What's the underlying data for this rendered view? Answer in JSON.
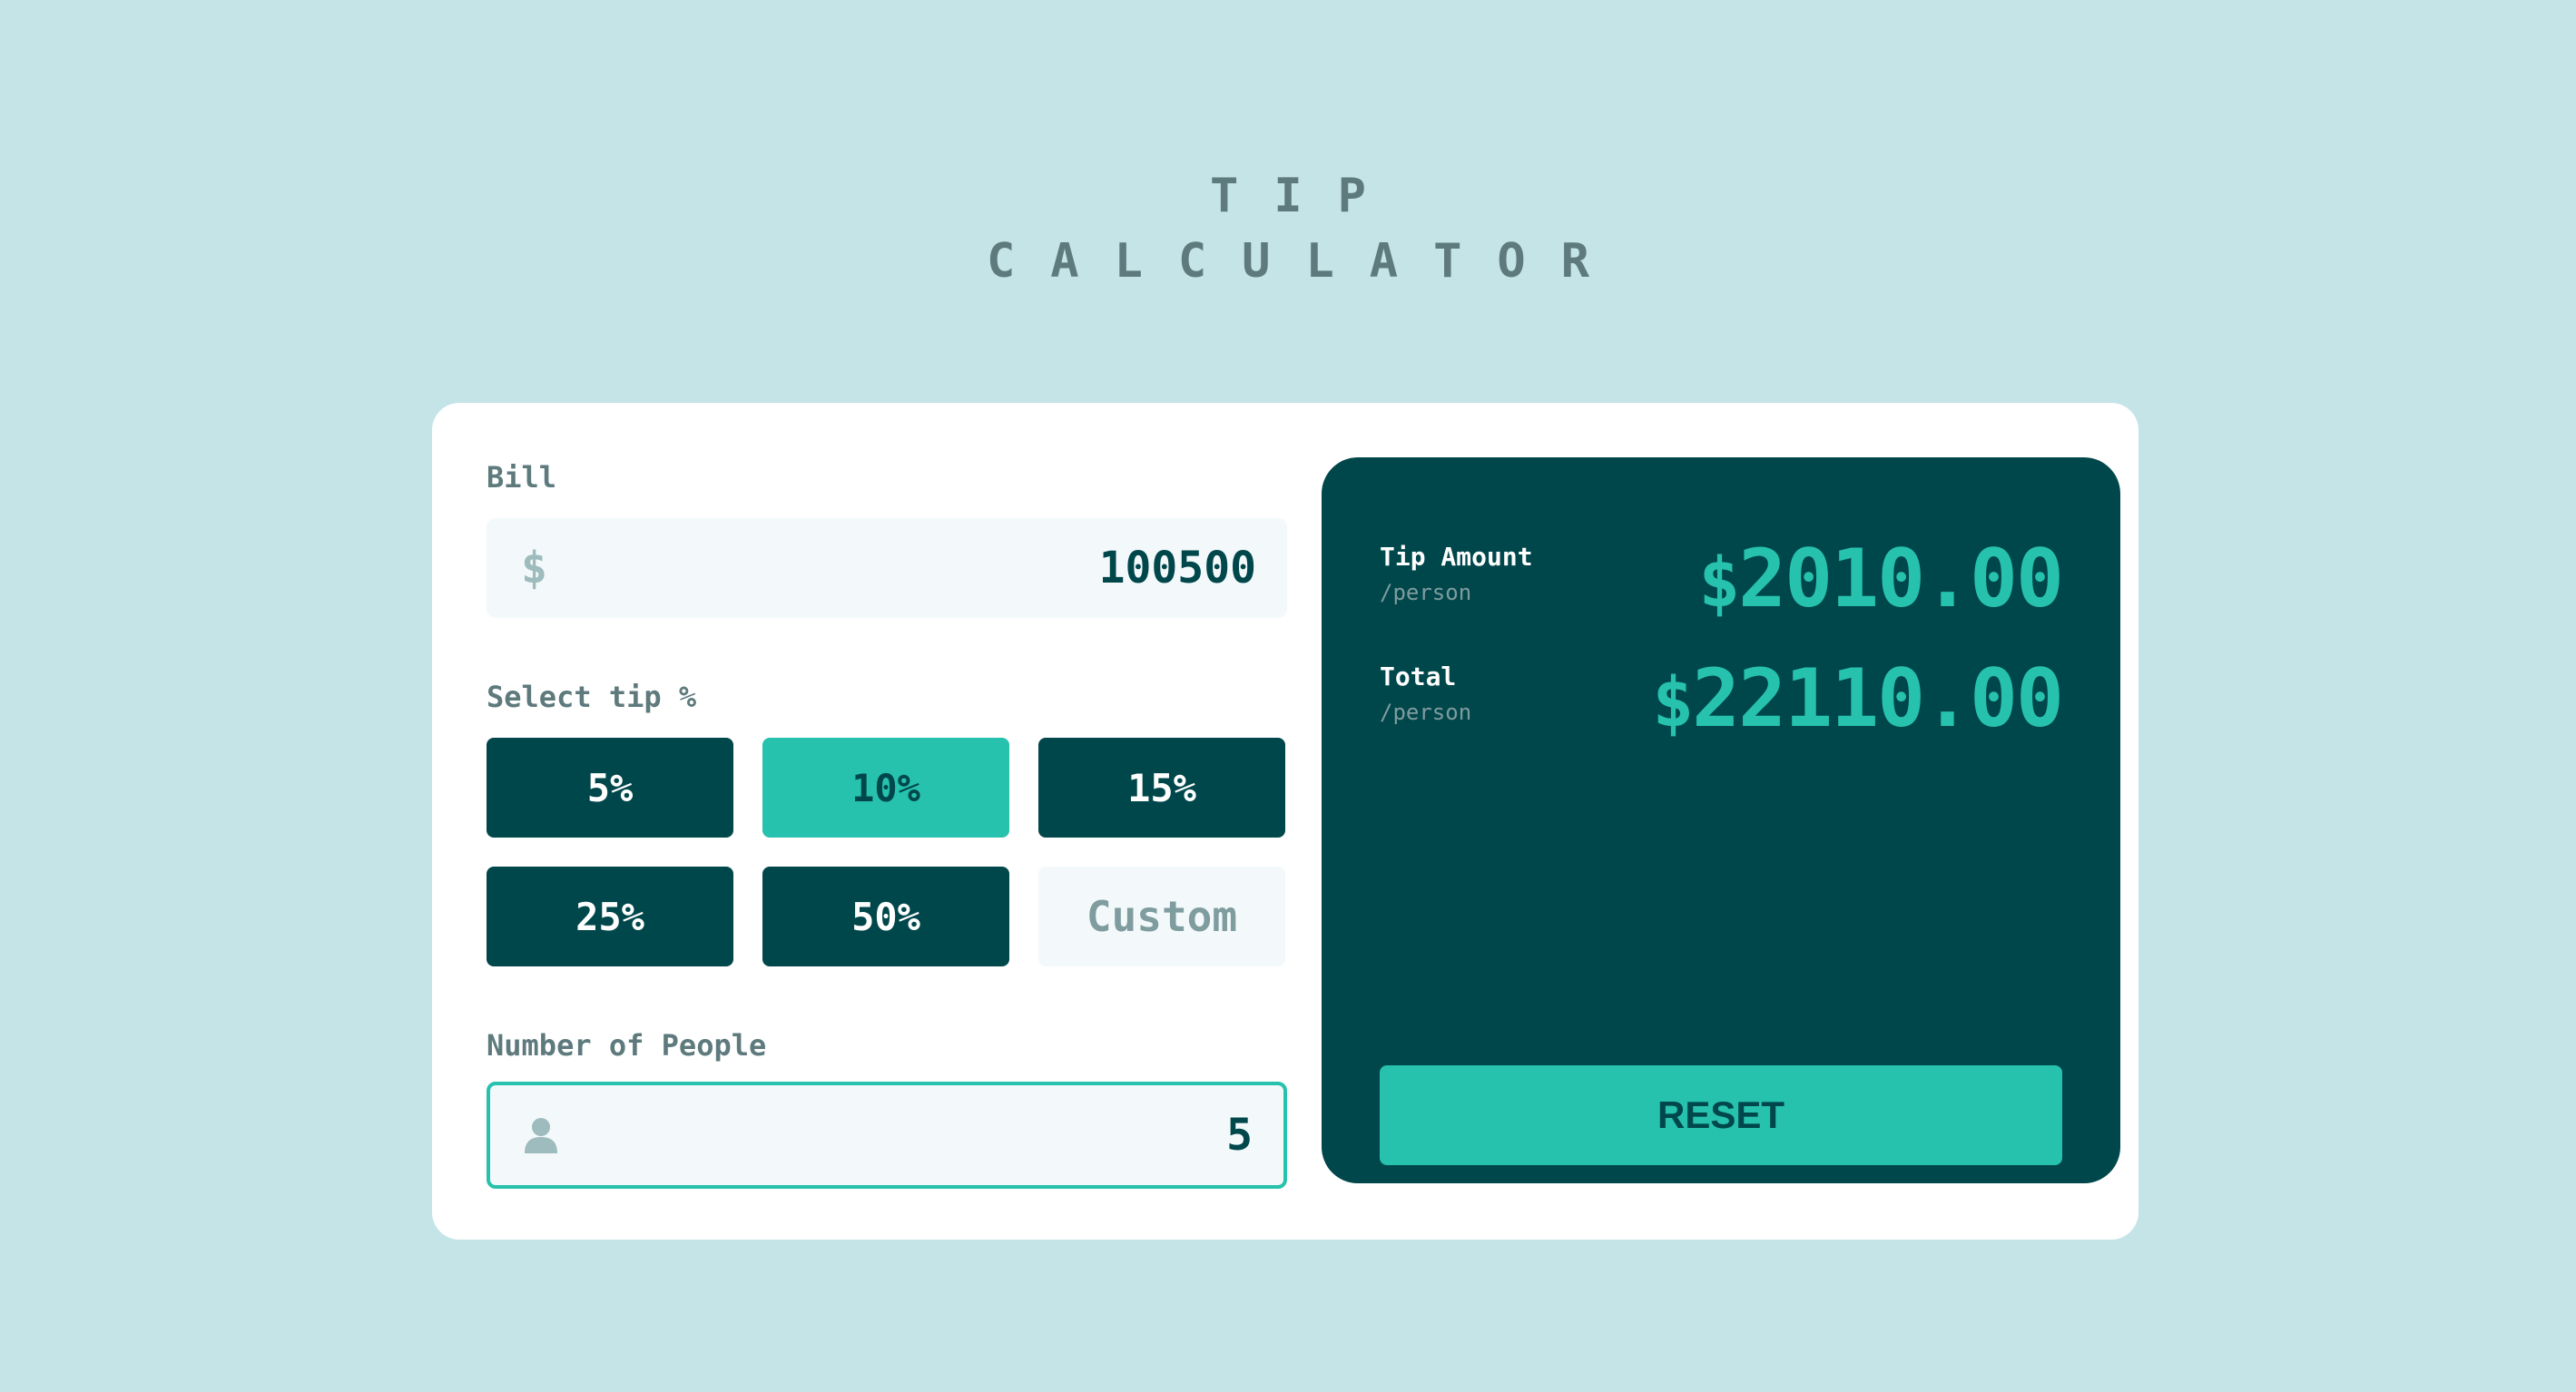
{
  "app": {
    "title_line1": "TIP",
    "title_line2": "CALCULATOR"
  },
  "bill": {
    "label": "Bill",
    "currency_icon": "dollar-icon",
    "currency_symbol": "$",
    "value": "100500"
  },
  "tip": {
    "label": "Select tip %",
    "options": [
      "5%",
      "10%",
      "15%",
      "25%",
      "50%"
    ],
    "selected": "10%",
    "custom_placeholder": "Custom"
  },
  "people": {
    "label": "Number of People",
    "icon": "person-icon",
    "value": "5"
  },
  "results": {
    "tip_amount": {
      "label": "Tip Amount",
      "sub": "/person",
      "currency": "$",
      "value": "2010.00"
    },
    "total": {
      "label": "Total",
      "sub": "/person",
      "currency": "$",
      "value": "22110.00"
    },
    "reset_label": "RESET"
  },
  "colors": {
    "background": "#c5e4e7",
    "card": "#ffffff",
    "dark_cyan": "#00474b",
    "accent": "#26c2ad",
    "input_bg": "#f3f9fa",
    "label_gray": "#5e7a7d"
  }
}
